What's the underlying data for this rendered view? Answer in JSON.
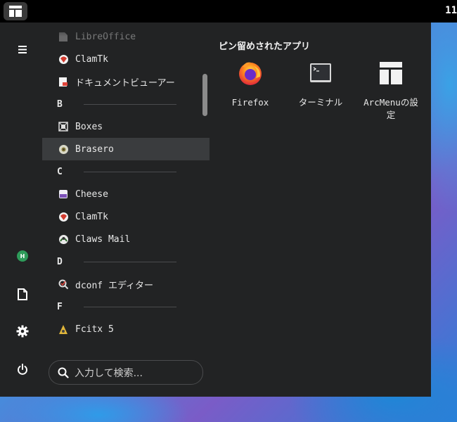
{
  "topbar": {
    "clock": "11"
  },
  "pinned": {
    "title": "ピン留めされたアプリ",
    "apps": [
      {
        "label": "Firefox",
        "icon": "firefox-icon"
      },
      {
        "label": "ターミナル",
        "icon": "terminal-icon"
      },
      {
        "label": "ArcMenuの設定",
        "icon": "arcmenu-settings-icon"
      }
    ]
  },
  "app_list": {
    "items": [
      {
        "type": "app",
        "label": "LibreOffice",
        "icon": "libreoffice-icon"
      },
      {
        "type": "app",
        "label": "ClamTk",
        "icon": "clamtk-icon"
      },
      {
        "type": "app",
        "label": "ドキュメントビューアー",
        "icon": "document-viewer-icon"
      },
      {
        "type": "header",
        "label": "B"
      },
      {
        "type": "app",
        "label": "Boxes",
        "icon": "boxes-icon"
      },
      {
        "type": "app",
        "label": "Brasero",
        "icon": "brasero-icon",
        "selected": true
      },
      {
        "type": "header",
        "label": "C"
      },
      {
        "type": "app",
        "label": "Cheese",
        "icon": "cheese-icon"
      },
      {
        "type": "app",
        "label": "ClamTk",
        "icon": "clamtk-icon"
      },
      {
        "type": "app",
        "label": "Claws Mail",
        "icon": "claws-mail-icon"
      },
      {
        "type": "header",
        "label": "D"
      },
      {
        "type": "app",
        "label": "dconf エディター",
        "icon": "dconf-editor-icon"
      },
      {
        "type": "header",
        "label": "F"
      },
      {
        "type": "app",
        "label": "Fcitx 5",
        "icon": "fcitx-icon"
      }
    ]
  },
  "search": {
    "placeholder": "入力して検索..."
  },
  "rail": {
    "avatar_letter": "H",
    "buttons": [
      "hamburger-menu-icon",
      "avatar",
      "documents-icon",
      "settings-gear-icon",
      "power-icon"
    ]
  },
  "colors": {
    "menu_bg": "#222324",
    "selected_bg": "#3a3c3e",
    "avatar_green": "#2e9b5a"
  }
}
